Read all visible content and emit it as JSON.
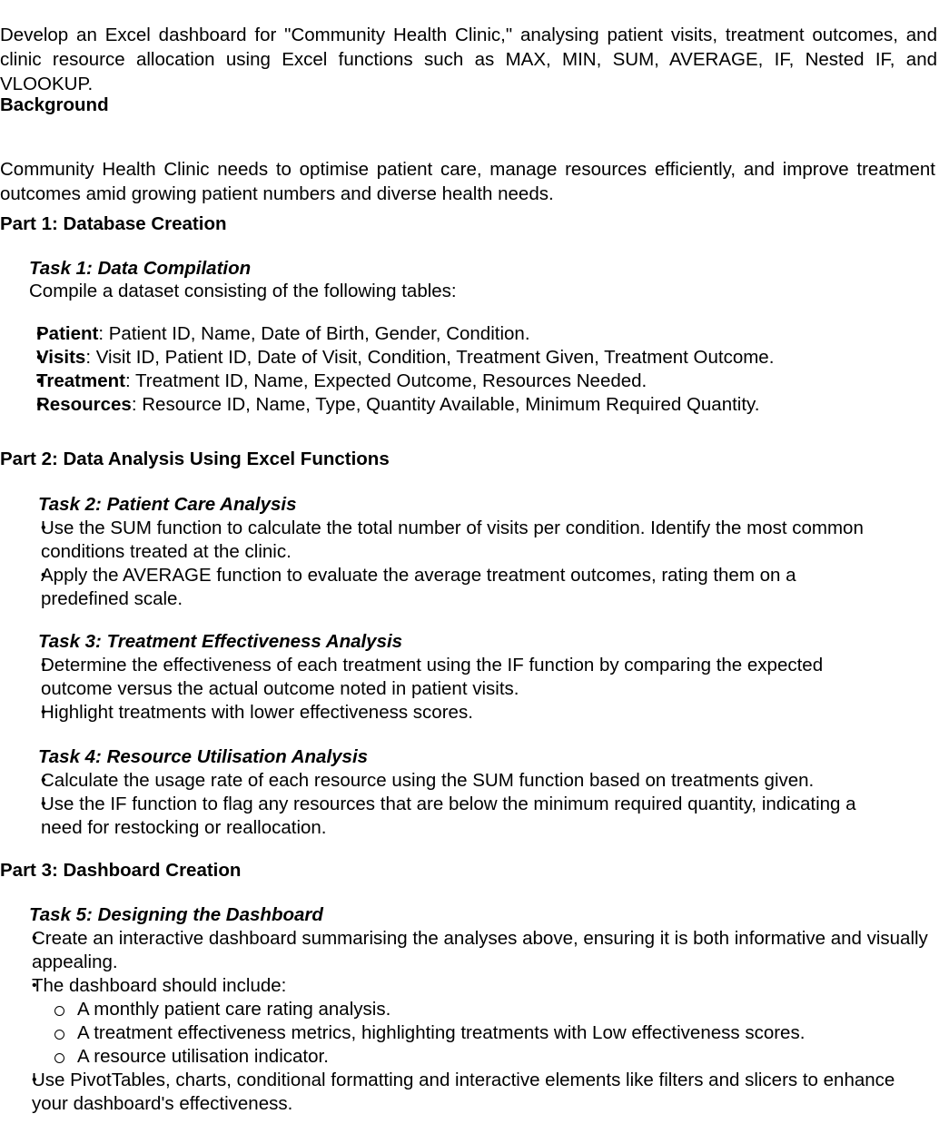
{
  "document": {
    "intro": {
      "text": "Develop an Excel dashboard for \"Community Health Clinic,\" analysing patient visits, treatment outcomes, and clinic resource allocation using Excel functions such as MAX, MIN, SUM, AVERAGE, IF, Nested IF, and VLOOKUP."
    },
    "background": {
      "heading": "Background",
      "paragraph": "Community Health Clinic needs to optimise patient care, manage resources efficiently, and improve treatment outcomes amid growing patient numbers and diverse health needs."
    },
    "part1": {
      "heading": "Part 1: Database Creation",
      "task1": {
        "heading": "Task 1: Data Compilation",
        "intro": "Compile a dataset consisting of the following tables:",
        "tables": [
          {
            "bullet": "•",
            "label": "Patient",
            "fields": ": Patient ID, Name, Date of Birth, Gender, Condition."
          },
          {
            "bullet": "•",
            "label": "Visits",
            "fields": ": Visit ID, Patient ID, Date of Visit, Condition, Treatment Given, Treatment Outcome."
          },
          {
            "bullet": "•",
            "label": "Treatment",
            "fields": ": Treatment ID, Name, Expected Outcome, Resources Needed."
          },
          {
            "bullet": "•",
            "label": "Resources",
            "fields": ": Resource ID, Name, Type, Quantity Available, Minimum Required Quantity."
          }
        ]
      }
    },
    "part2": {
      "heading": "Part 2: Data Analysis Using Excel Functions",
      "task2": {
        "heading": "Task 2: Patient Care Analysis",
        "bullets": [
          "Use the SUM function to calculate the total number of visits per condition. Identify the most common conditions treated at the clinic.",
          "Apply the AVERAGE function to evaluate the average treatment outcomes, rating them on a predefined scale."
        ]
      },
      "task3": {
        "heading": "Task 3: Treatment Effectiveness Analysis",
        "bullets": [
          "Determine the effectiveness of each treatment using the IF function by comparing the expected outcome versus the actual outcome noted in patient visits.",
          "Highlight treatments with lower effectiveness scores."
        ]
      },
      "task4": {
        "heading": "Task 4: Resource Utilisation Analysis",
        "bullets": [
          "Calculate the usage rate of each resource using the SUM function based on treatments given.",
          "Use the IF function to flag any resources that are below the minimum required quantity, indicating a need for restocking or reallocation."
        ]
      }
    },
    "part3": {
      "heading": "Part 3: Dashboard Creation",
      "task5": {
        "heading": "Task 5: Designing the Dashboard",
        "bullet1": "Create an interactive dashboard summarising the analyses above, ensuring it is both informative and visually appealing.",
        "bullet2": "The dashboard should include:",
        "subbullets": [
          "A monthly patient care rating analysis.",
          "A treatment effectiveness metrics, highlighting treatments with Low effectiveness scores.",
          "A resource utilisation indicator."
        ],
        "bullet3": "Use PivotTables, charts, conditional formatting and interactive elements like filters and slicers to enhance your dashboard's effectiveness."
      }
    },
    "bullet_glyphs": {
      "disc": "•"
    }
  }
}
